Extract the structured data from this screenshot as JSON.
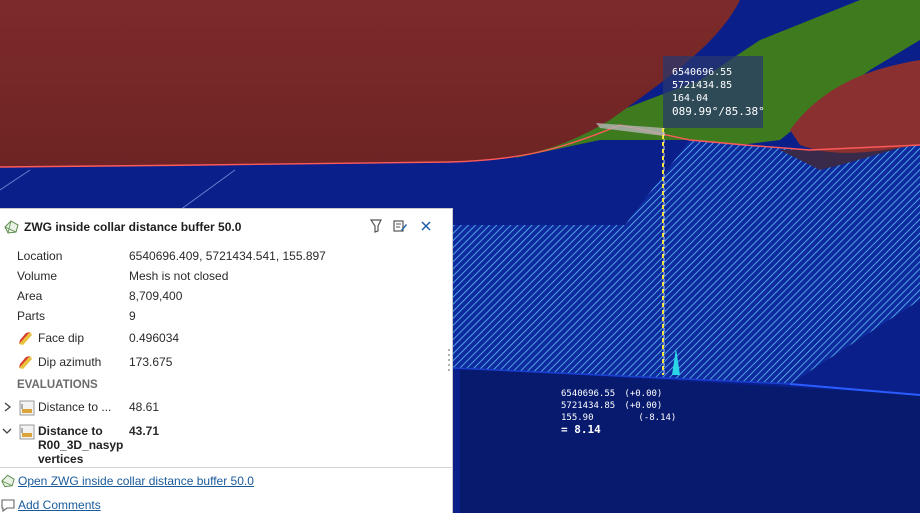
{
  "viewport": {
    "colors": {
      "background": "#0a1f8a",
      "surface_red": "#7a2a2a",
      "surface_green": "#3e7a1e",
      "hatch": "#4fb3e8",
      "measure": "#f5e23a"
    },
    "tooltip": {
      "line1": "6540696.55",
      "line2": "5721434.85",
      "line3": "164.04",
      "line4": "089.99°/85.38°"
    },
    "readout": {
      "x": "6540696.55",
      "x_delta": "(+0.00)",
      "y": "5721434.85",
      "y_delta": "(+0.00)",
      "z": "155.90",
      "z_delta": "(-8.14)",
      "distance": "= 8.14"
    }
  },
  "panel": {
    "title": "ZWG inside collar distance buffer 50.0",
    "header_icons": [
      "filter-icon",
      "edit-icon",
      "close-icon"
    ],
    "properties": [
      {
        "label": "Location",
        "value": "6540696.409, 5721434.541, 155.897"
      },
      {
        "label": "Volume",
        "value": "Mesh is not closed"
      },
      {
        "label": "Area",
        "value": "8,709,400"
      },
      {
        "label": "Parts",
        "value": "9"
      },
      {
        "label": "Face dip",
        "value": "0.496034"
      },
      {
        "label": "Dip azimuth",
        "value": "173.675"
      }
    ],
    "evaluations_header": "EVALUATIONS",
    "evaluations": [
      {
        "label": "Distance to ...",
        "value": "48.61"
      },
      {
        "label_line1": "Distance to",
        "label_line2": "R00_3D_nasyp",
        "label_line3": "vertices",
        "value": "43.71"
      }
    ],
    "open_link": "Open ZWG inside collar distance buffer 50.0",
    "comments_link": "Add Comments"
  }
}
